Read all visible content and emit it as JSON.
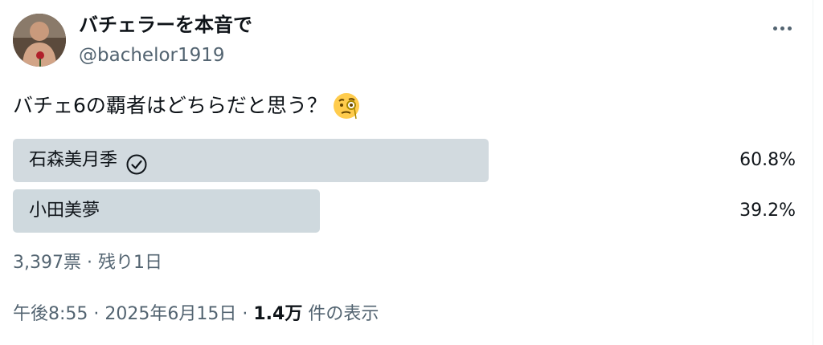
{
  "author": {
    "display_name": "バチェラーを本音で",
    "handle": "@bachelor1919"
  },
  "tweet": {
    "text": "バチェ6の覇者はどちらだと思う？",
    "emoji_icon": "monocle-face-icon"
  },
  "poll": {
    "options": [
      {
        "label": "石森美月季",
        "percent": "60.8%",
        "fraction": 0.608,
        "winner": true
      },
      {
        "label": "小田美夢",
        "percent": "39.2%",
        "fraction": 0.392,
        "winner": false
      }
    ],
    "votes_text": "3,397票",
    "separator": " · ",
    "remaining_text": "残り1日"
  },
  "meta": {
    "time": "午後8:55",
    "separator": " · ",
    "date": "2025年6月15日",
    "views_count": "1.4万",
    "views_label": " 件の表示"
  },
  "colors": {
    "poll_bar": "#cfd9de",
    "secondary_text": "#536471",
    "primary_text": "#0f1419"
  }
}
